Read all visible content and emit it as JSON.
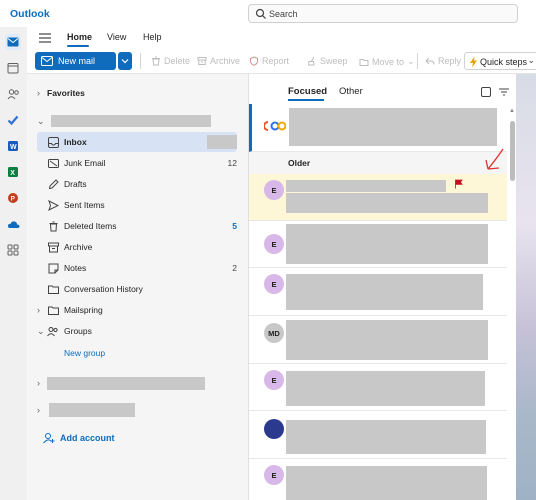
{
  "app": {
    "title": "Outlook",
    "brand_color": "#0f6cbd"
  },
  "search": {
    "placeholder": "Search"
  },
  "ribbon": {
    "tabs": [
      {
        "label": "Home"
      },
      {
        "label": "View"
      },
      {
        "label": "Help"
      }
    ],
    "new_mail": "New mail",
    "actions": [
      {
        "label": "Delete",
        "icon": "trash-icon"
      },
      {
        "label": "Archive",
        "icon": "archive-icon"
      },
      {
        "label": "Report",
        "icon": "shield-icon"
      },
      {
        "label": "Sweep",
        "icon": "broom-icon"
      },
      {
        "label": "Move to",
        "icon": "folder-move-icon"
      },
      {
        "label": "Reply",
        "icon": "reply-icon"
      }
    ],
    "quick_steps": "Quick steps"
  },
  "folders": {
    "favorites": "Favorites",
    "items": [
      {
        "label": "Inbox",
        "count": ""
      },
      {
        "label": "Junk Email",
        "count": "12"
      },
      {
        "label": "Drafts",
        "count": ""
      },
      {
        "label": "Sent Items",
        "count": ""
      },
      {
        "label": "Deleted Items",
        "count": "5"
      },
      {
        "label": "Archive",
        "count": ""
      },
      {
        "label": "Notes",
        "count": "2"
      },
      {
        "label": "Conversation History",
        "count": ""
      },
      {
        "label": "Mailspring",
        "count": ""
      }
    ],
    "groups": "Groups",
    "new_group": "New group",
    "add_account": "Add account"
  },
  "message_list": {
    "tabs": [
      {
        "label": "Focused"
      },
      {
        "label": "Other"
      }
    ],
    "older_header": "Older",
    "messages": [
      {
        "avatar": ""
      },
      {
        "avatar": "E"
      },
      {
        "avatar": "E"
      },
      {
        "avatar": "E"
      },
      {
        "avatar": "MD"
      },
      {
        "avatar": "E"
      },
      {
        "avatar": ""
      },
      {
        "avatar": "E"
      }
    ]
  },
  "colors": {
    "accent": "#0f6cbd",
    "flag": "#c50f1f",
    "avatar_e": "#d7b8e8",
    "avatar_navy": "#2b3a8f"
  }
}
